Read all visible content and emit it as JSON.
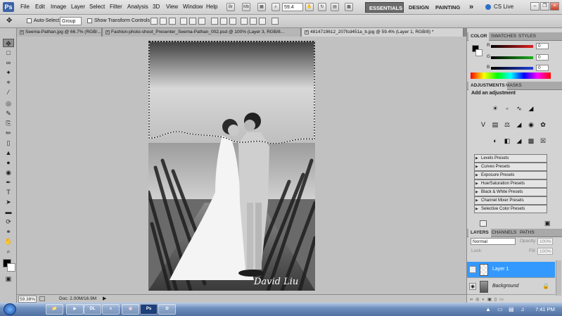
{
  "menubar": {
    "logo": "Ps",
    "items": [
      "File",
      "Edit",
      "Image",
      "Layer",
      "Select",
      "Filter",
      "Analysis",
      "3D",
      "View",
      "Window",
      "Help"
    ],
    "icons": [
      "br-icon",
      "mb-icon",
      "grid-icon",
      "screen-mode-icon",
      "hand-icon",
      "zoom-icon",
      "rotate-icon",
      "arrange-icon"
    ],
    "zoom": "59.4",
    "workspaces": [
      "ESSENTIALS",
      "DESIGN",
      "PAINTING"
    ],
    "more": "»",
    "cs_live": "CS Live"
  },
  "options": {
    "auto_select_label": "Auto-Select:",
    "auto_select_value": "Group",
    "show_transform_label": "Show Transform Controls"
  },
  "tabs": [
    {
      "label": "Seema-Pathan.jpg @ 66.7% (RGB/...",
      "active": false
    },
    {
      "label": "Fashion-photo-shoot_Presenter_Seema-Pathan_002.psd @ 100% (Layer 3, RGB/8...",
      "active": false
    },
    {
      "label": "4814719612_207fcd451a_b.jpg @ 59.4% (Layer 1, RGB/8) *",
      "active": true
    }
  ],
  "tools": [
    "move-tool",
    "marquee-tool",
    "lasso-tool",
    "quick-select-tool",
    "crop-tool",
    "eyedropper-tool",
    "healing-tool",
    "brush-tool",
    "clone-stamp-tool",
    "history-brush-tool",
    "eraser-tool",
    "gradient-tool",
    "blur-tool",
    "dodge-tool",
    "pen-tool",
    "type-tool",
    "path-select-tool",
    "shape-tool",
    "3d-rotate-tool",
    "3d-orbit-tool",
    "hand-tool",
    "zoom-tool"
  ],
  "status": {
    "zoom": "59.38%",
    "doc": "Doc: 2.00M/16.9M"
  },
  "color_panel": {
    "tabs": [
      "COLOR",
      "SWATCHES",
      "STYLES"
    ],
    "channels": [
      {
        "label": "R",
        "value": "0",
        "color": "#e02020"
      },
      {
        "label": "G",
        "value": "0",
        "color": "#20b020"
      },
      {
        "label": "B",
        "value": "0",
        "color": "#2040e0"
      }
    ]
  },
  "adjustments_panel": {
    "tabs": [
      "ADJUSTMENTS",
      "MASKS"
    ],
    "heading": "Add an adjustment",
    "presets": [
      "Levels Presets",
      "Curves Presets",
      "Exposure Presets",
      "Hue/Saturation Presets",
      "Black & White Presets",
      "Channel Mixer Presets",
      "Selective Color Presets"
    ]
  },
  "layers_panel": {
    "tabs": [
      "LAYERS",
      "CHANNELS",
      "PATHS"
    ],
    "blend_mode": "Normal",
    "opacity_label": "Opacity:",
    "opacity_value": "100%",
    "lock_label": "Lock:",
    "fill_label": "Fill:",
    "fill_value": "100%",
    "layers": [
      {
        "name": "Layer 1",
        "selected": true
      },
      {
        "name": "Background",
        "selected": false
      }
    ]
  },
  "photo": {
    "watermark": "David Liu"
  },
  "taskbar": {
    "apps": [
      "explorer-icon",
      "media-player-icon",
      "dl-icon",
      "ie-icon",
      "media-icon",
      "photoshop-icon",
      "paint-icon"
    ],
    "dl_text": "DL",
    "ps_text": "Ps",
    "clock": "7:41 PM"
  },
  "colors": {
    "accent_selected": "#3399ff",
    "taskbar": "#4e6f9f"
  }
}
